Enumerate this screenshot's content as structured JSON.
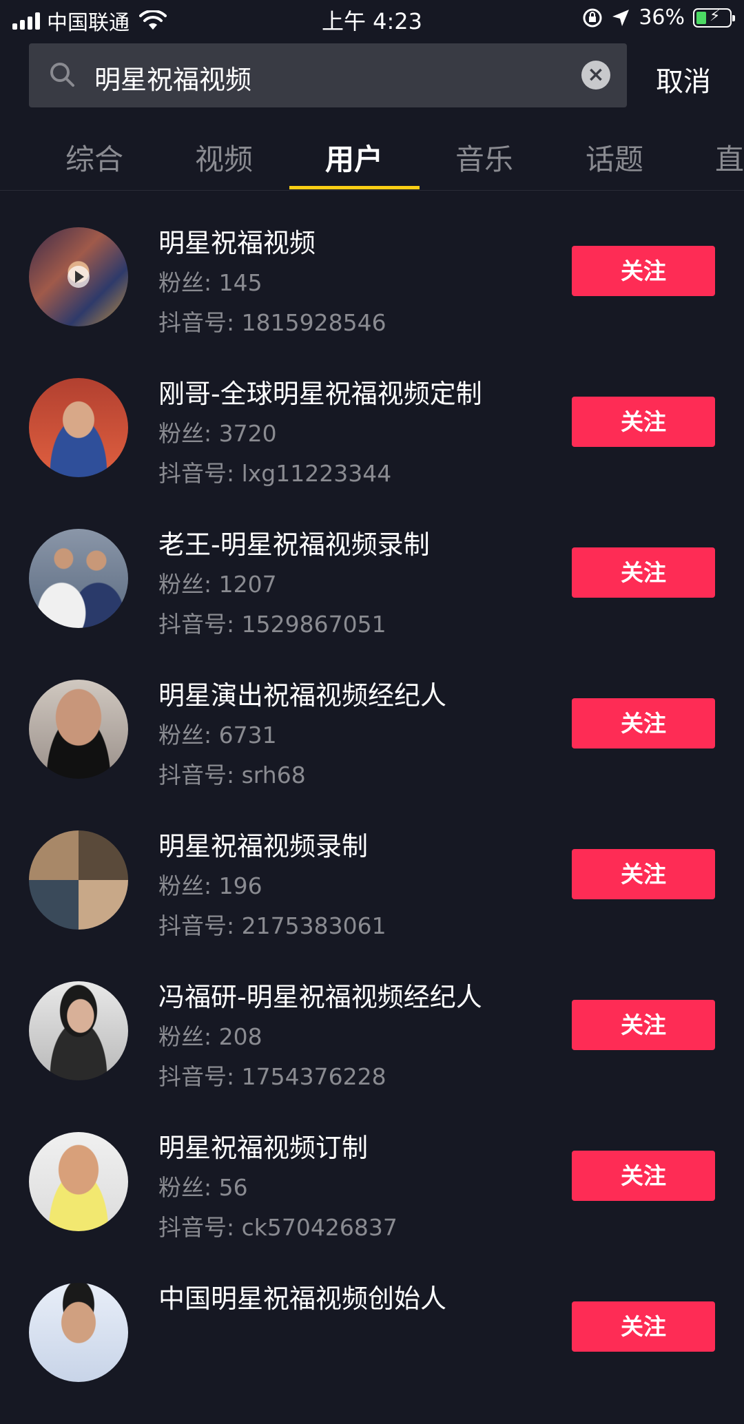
{
  "status_bar": {
    "carrier": "中国联通",
    "time": "上午 4:23",
    "battery_pct": "36%",
    "icons": [
      "signal-icon",
      "wifi-icon",
      "rotation-lock-icon",
      "location-arrow-icon",
      "battery-charging-icon"
    ]
  },
  "search": {
    "query": "明星祝福视频",
    "clear_icon": "×",
    "cancel_label": "取消"
  },
  "tabs": [
    {
      "label": "综合",
      "active": false
    },
    {
      "label": "视频",
      "active": false
    },
    {
      "label": "用户",
      "active": true
    },
    {
      "label": "音乐",
      "active": false
    },
    {
      "label": "话题",
      "active": false
    },
    {
      "label": "直",
      "active": false
    }
  ],
  "colors": {
    "background": "#161823",
    "follow_button": "#fe2c55",
    "tab_indicator": "#face15",
    "secondary_text": "#8a8b91"
  },
  "users": [
    {
      "name": "明星祝福视频",
      "fans": "粉丝: 145",
      "douyin_id": "抖音号: 1815928546",
      "follow_label": "关注"
    },
    {
      "name": "刚哥-全球明星祝福视频定制",
      "fans": "粉丝: 3720",
      "douyin_id": "抖音号: lxg11223344",
      "follow_label": "关注"
    },
    {
      "name": "老王-明星祝福视频录制",
      "fans": "粉丝: 1207",
      "douyin_id": "抖音号: 1529867051",
      "follow_label": "关注"
    },
    {
      "name": "明星演出祝福视频经纪人",
      "fans": "粉丝: 6731",
      "douyin_id": "抖音号: srh68",
      "follow_label": "关注"
    },
    {
      "name": "明星祝福视频录制",
      "fans": "粉丝: 196",
      "douyin_id": "抖音号: 2175383061",
      "follow_label": "关注"
    },
    {
      "name": "冯福研-明星祝福视频经纪人",
      "fans": "粉丝: 208",
      "douyin_id": "抖音号: 1754376228",
      "follow_label": "关注"
    },
    {
      "name": "明星祝福视频订制",
      "fans": "粉丝: 56",
      "douyin_id": "抖音号: ck570426837",
      "follow_label": "关注"
    },
    {
      "name": "中国明星祝福视频创始人",
      "fans": "",
      "douyin_id": "",
      "follow_label": "关注"
    }
  ]
}
